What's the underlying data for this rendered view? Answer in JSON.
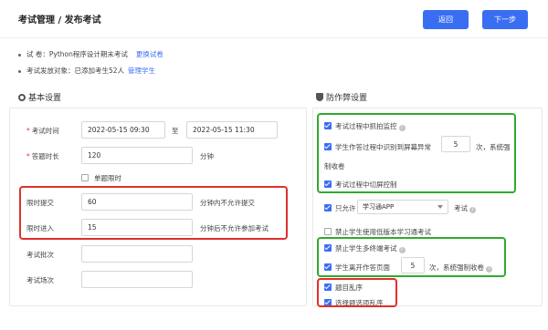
{
  "header": {
    "title": "考试管理 / 发布考试",
    "back_label": "返回",
    "next_label": "下一步"
  },
  "info": {
    "paper_label": "试 卷：",
    "paper_value": "Python程序设计期末考试",
    "paper_link": "更换试卷",
    "target_label": "考试发放对象：",
    "target_value": "已添加考生52人",
    "target_link": "管理学生"
  },
  "basic": {
    "title": "基本设置",
    "time_label": "考试时间",
    "start_time": "2022-05-15 09:30",
    "to_label": "至",
    "end_time": "2022-05-15 11:30",
    "duration_label": "答题时长",
    "duration_value": "120",
    "duration_unit": "分钟",
    "single_limit_label": "单题限时",
    "submit_limit_label": "限时提交",
    "submit_limit_value": "60",
    "submit_limit_suffix": "分钟内不允许提交",
    "enter_limit_label": "限时进入",
    "enter_limit_value": "15",
    "enter_limit_suffix": "分钟后不允许参加考试",
    "batch_label": "考试批次",
    "batch_value": "",
    "site_label": "考试场次",
    "site_value": ""
  },
  "anti": {
    "title": "防作弊设置",
    "capture_label": "考试过程中抓拍监控",
    "screen_label_a": "学生作答过程中识别到屏幕异常",
    "screen_count": "5",
    "screen_label_b": "次，系统强",
    "screen_label_c": "制收卷",
    "split_label": "考试过程中切屏控制",
    "only_allow_label": "只允许",
    "app_option": "学习通APP",
    "exam_label": "考试",
    "lowver_label": "禁止学生使用低版本学习通考试",
    "multi_label": "禁止学生多终端考试",
    "leave_label": "学生离开作答页面",
    "leave_count": "5",
    "leave_suffix": "次，系统强制收卷",
    "shuffle_q_label": "题目乱序",
    "shuffle_opt_label": "选择题选项乱序"
  },
  "colors": {
    "accent": "#3a6ef2",
    "red_box": "#e0302a",
    "green_box": "#2faa2f"
  },
  "icons": {
    "basic": "gear-icon",
    "anti": "shield-icon",
    "info": "info-icon"
  }
}
